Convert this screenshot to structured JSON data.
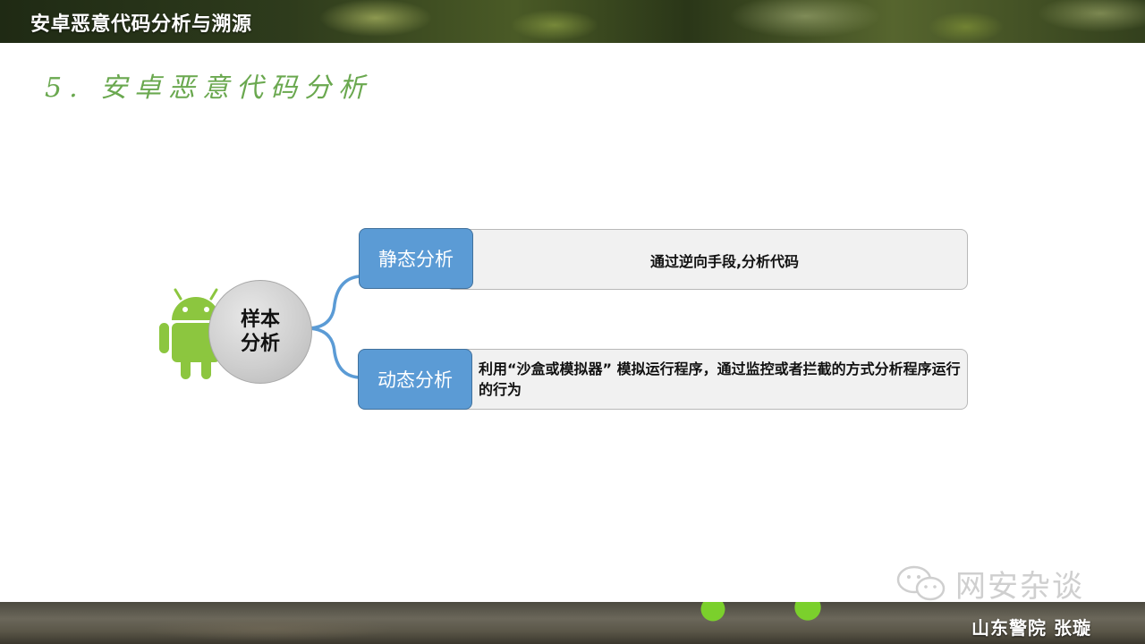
{
  "slide": {
    "header_title": "安卓恶意代码分析与溯源",
    "section_title": "5. 安卓恶意代码分析",
    "footer_author": "山东警院  张璇",
    "watermark_text": "网安杂谈"
  },
  "diagram": {
    "center": {
      "label": "样本分析",
      "icon": "android-robot-icon"
    },
    "branches": [
      {
        "tag": "静态分析",
        "description": "通过逆向手段,分析代码"
      },
      {
        "tag": "动态分析",
        "description": "利用“沙盒或模拟器” 模拟运行程序，通过监控或者拦截的方式分析程序运行的行为"
      }
    ]
  },
  "colors": {
    "section_title": "#6aa84f",
    "tag_fill": "#5b9bd5",
    "connector": "#5b9bd5",
    "android_green": "#8cc63f",
    "desc_fill": "#f1f1f1"
  }
}
